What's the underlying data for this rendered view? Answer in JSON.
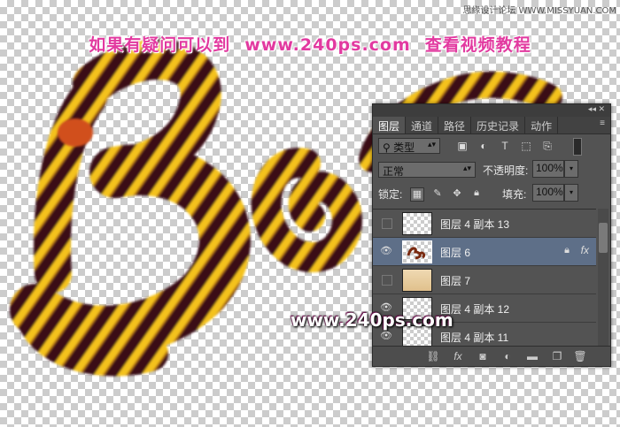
{
  "banner": {
    "left": "如果有疑问可以到",
    "url": "www.240ps.com",
    "right": "查看视频教程"
  },
  "corner_text": "思缘设计论坛 WWW.MISSYUAN.COM",
  "watermark": "www.240ps.com",
  "colors": {
    "stripe_yellow": "#f4c21a",
    "stripe_dark": "#3a0a14",
    "banner": "#e23aa0",
    "panel_bg": "#535353",
    "selected_row": "#5e6f88"
  },
  "panel": {
    "tabs": [
      "图层",
      "通道",
      "路径",
      "历史记录",
      "动作"
    ],
    "active_tab": "图层",
    "filter": {
      "label": "类型",
      "icons": [
        "image-icon",
        "adjustment-icon",
        "type-icon",
        "shape-icon",
        "smart-object-icon"
      ]
    },
    "blend_mode": "正常",
    "opacity_label": "不透明度:",
    "opacity_value": "100%",
    "lock_label": "锁定:",
    "fill_label": "填充:",
    "fill_value": "100%",
    "layers": [
      {
        "name": "图层 4 副本 13",
        "visible": false,
        "thumb": "checker",
        "selected": false,
        "fx": false
      },
      {
        "name": "图层 6",
        "visible": true,
        "thumb": "art",
        "selected": true,
        "fx": true
      },
      {
        "name": "图层 7",
        "visible": false,
        "thumb": "gradient",
        "selected": false,
        "fx": false
      },
      {
        "name": "图层 4 副本 12",
        "visible": true,
        "thumb": "checker",
        "selected": false,
        "fx": false
      },
      {
        "name": "图层 4 副本 11",
        "visible": true,
        "thumb": "checker",
        "selected": false,
        "fx": false
      }
    ],
    "bottom_icons": [
      "link-icon",
      "fx-icon",
      "mask-icon",
      "adjustment-layer-icon",
      "folder-icon",
      "new-layer-icon",
      "trash-icon"
    ]
  }
}
